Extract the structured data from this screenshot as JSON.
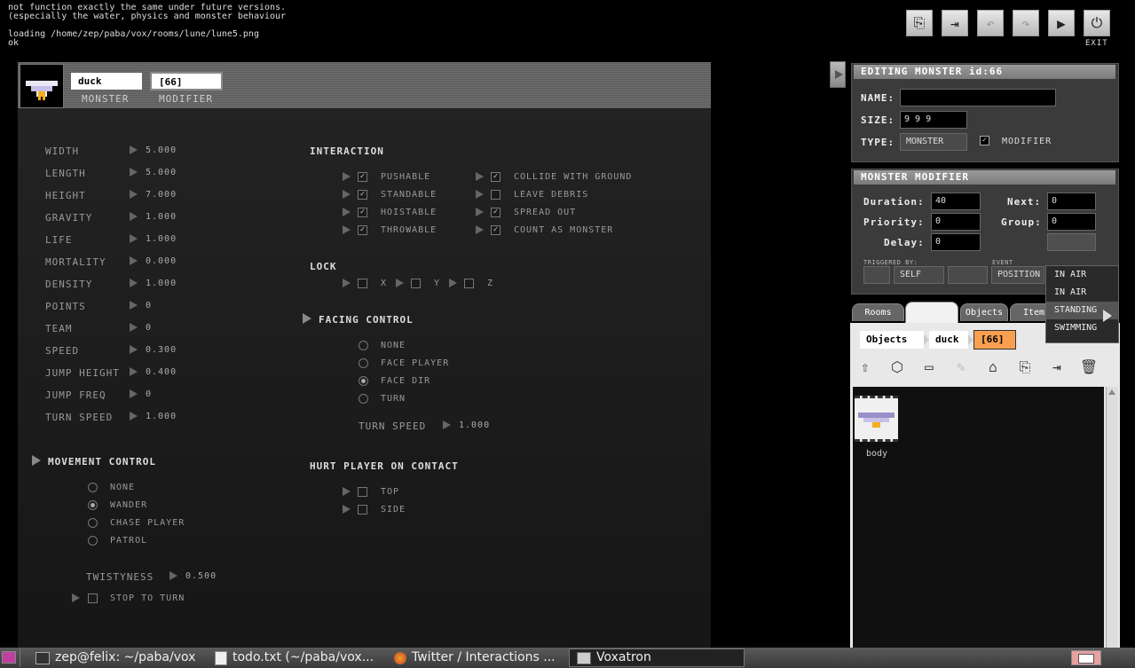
{
  "log": {
    "line1": "not function exactly the same under future versions.",
    "line2": "(especially the water, physics and monster behaviour",
    "line3": "loading /home/zep/paba/vox/rooms/lune/lune5.png",
    "line4": "ok"
  },
  "toolbar": {
    "exit_label": "EXIT"
  },
  "header": {
    "monster_name": "duck",
    "modifier_value": "[66]",
    "monster_label": "MONSTER",
    "modifier_label": "MODIFIER"
  },
  "props": [
    {
      "label": "WIDTH",
      "value": "5.000"
    },
    {
      "label": "LENGTH",
      "value": "5.000"
    },
    {
      "label": "HEIGHT",
      "value": "7.000"
    },
    {
      "label": "GRAVITY",
      "value": "1.000"
    },
    {
      "label": "LIFE",
      "value": "1.000"
    },
    {
      "label": "MORTALITY",
      "value": "0.000"
    },
    {
      "label": "DENSITY",
      "value": "1.000"
    },
    {
      "label": "POINTS",
      "value": "0"
    },
    {
      "label": "TEAM",
      "value": "0"
    },
    {
      "label": "SPEED",
      "value": "0.300"
    },
    {
      "label": "JUMP HEIGHT",
      "value": "0.400"
    },
    {
      "label": "JUMP FREQ",
      "value": "0"
    },
    {
      "label": "TURN SPEED",
      "value": "1.000"
    }
  ],
  "movement": {
    "title": "MOVEMENT CONTROL",
    "options": [
      "NONE",
      "WANDER",
      "CHASE PLAYER",
      "PATROL"
    ],
    "twisty_label": "TWISTYNESS",
    "twisty_value": "0.500",
    "stop_label": "STOP TO TURN"
  },
  "interaction": {
    "title": "INTERACTION",
    "left": [
      "PUSHABLE",
      "STANDABLE",
      "HOISTABLE",
      "THROWABLE"
    ],
    "right": [
      "COLLIDE WITH GROUND",
      "LEAVE DEBRIS",
      "SPREAD OUT",
      "COUNT AS MONSTER"
    ]
  },
  "lock": {
    "title": "LOCK",
    "x": "X",
    "y": "Y",
    "z": "Z"
  },
  "facing": {
    "title": "FACING CONTROL",
    "options": [
      "NONE",
      "FACE PLAYER",
      "FACE DIR",
      "TURN"
    ],
    "turn_speed_label": "TURN SPEED",
    "turn_speed_value": "1.000"
  },
  "hurt": {
    "title": "HURT PLAYER ON CONTACT",
    "options": [
      "TOP",
      "SIDE"
    ]
  },
  "editing": {
    "title": "EDITING MONSTER id:66",
    "name_label": "NAME:",
    "name_value": "",
    "size_label": "SIZE:",
    "size_value": "9 9 9",
    "type_label": "TYPE:",
    "type_value": "MONSTER",
    "modifier_label": "MODIFIER"
  },
  "modifier": {
    "title": "MONSTER MODIFIER",
    "duration_label": "Duration:",
    "duration_value": "40",
    "next_label": "Next:",
    "next_value": "0",
    "priority_label": "Priority:",
    "priority_value": "0",
    "group_label": "Group:",
    "group_value": "0",
    "delay_label": "Delay:",
    "delay_value": "0",
    "triggered_label": "TRIGGERED BY:",
    "triggered_value": "SELF",
    "event_label": "EVENT",
    "event_value": "POSITION"
  },
  "dropdown": [
    "IN AIR",
    "IN AIR",
    "STANDING",
    "SWIMMING"
  ],
  "tabs": [
    "Rooms",
    "",
    "Objects",
    "Item"
  ],
  "breadcrumbs": [
    "Objects",
    "duck",
    "[66]"
  ],
  "files": [
    {
      "name": "body"
    }
  ],
  "taskbar": [
    {
      "label": "zep@felix: ~/paba/vox"
    },
    {
      "label": "todo.txt (~/paba/vox..."
    },
    {
      "label": "Twitter / Interactions ..."
    },
    {
      "label": "Voxatron"
    }
  ]
}
